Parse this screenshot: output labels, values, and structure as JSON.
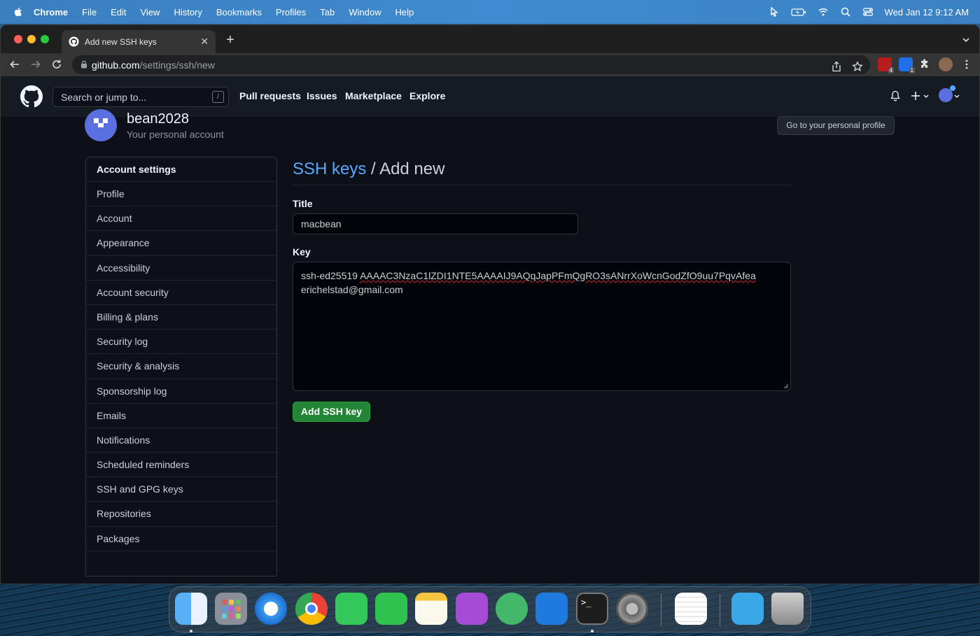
{
  "menubar": {
    "app": "Chrome",
    "items": [
      "File",
      "Edit",
      "View",
      "History",
      "Bookmarks",
      "Profiles",
      "Tab",
      "Window",
      "Help"
    ],
    "clock": "Wed Jan 12  9:12 AM"
  },
  "browser": {
    "tab_title": "Add new SSH keys",
    "url_host": "github.com",
    "url_path": "/settings/ssh/new",
    "ext_badges": [
      "4",
      "1"
    ]
  },
  "github": {
    "search_placeholder": "Search or jump to...",
    "search_shortcut": "/",
    "nav": [
      "Pull requests",
      "Issues",
      "Marketplace",
      "Explore"
    ]
  },
  "account": {
    "username": "bean2028",
    "subtitle": "Your personal account",
    "profile_button": "Go to your personal profile"
  },
  "sidebar": {
    "heading": "Account settings",
    "items": [
      "Profile",
      "Account",
      "Appearance",
      "Accessibility",
      "Account security",
      "Billing & plans",
      "Security log",
      "Security & analysis",
      "Sponsorship log",
      "Emails",
      "Notifications",
      "Scheduled reminders",
      "SSH and GPG keys",
      "Repositories",
      "Packages"
    ]
  },
  "form": {
    "breadcrumb_link": "SSH keys",
    "breadcrumb_sep": " / ",
    "breadcrumb_current": "Add new",
    "title_label": "Title",
    "title_value": "macbean",
    "key_label": "Key",
    "key_prefix": "ssh-ed25519 ",
    "key_body": "AAAAC3NzaC1lZDI1NTE5AAAAIJ9AQqJapPFmQgRO3sANrrXoWcnGodZfO9uu7PqvAfea",
    "key_email": "erichelstad@gmail.com",
    "submit": "Add SSH key"
  },
  "dock": {
    "apps": [
      "finder-icon",
      "launchpad-icon",
      "safari-icon",
      "chrome-icon",
      "messages-icon",
      "facetime-icon",
      "notes-icon",
      "podcasts-icon",
      "git-client-icon",
      "xcode-icon",
      "terminal-icon",
      "system-preferences-icon",
      "textedit-icon",
      "downloads-folder-icon",
      "trash-icon"
    ]
  }
}
